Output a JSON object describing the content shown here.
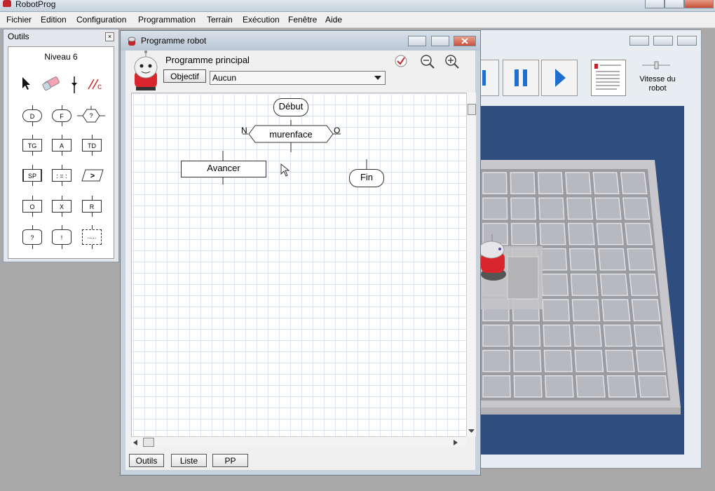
{
  "app": {
    "title": "RobotProg"
  },
  "menu": [
    "Fichier",
    "Edition",
    "Configuration",
    "Programmation",
    "Terrain",
    "Exécution",
    "Fenêtre",
    "Aide"
  ],
  "outils_panel": {
    "title": "Outils",
    "close": "×",
    "level": "Niveau 6",
    "tools": [
      {
        "label": "D"
      },
      {
        "label": "F"
      },
      {
        "label": "?"
      },
      {
        "label": "TG"
      },
      {
        "label": "A"
      },
      {
        "label": "TD"
      },
      {
        "label": "SP"
      },
      {
        "label": ": = :"
      },
      {
        "label": ">"
      },
      {
        "label": "O"
      },
      {
        "label": "X"
      },
      {
        "label": "R"
      },
      {
        "label": "?"
      },
      {
        "label": "!"
      },
      {
        "label": "....."
      }
    ]
  },
  "program_window": {
    "title": "Programme robot",
    "heading": "Programme principal",
    "objectif_button": "Objectif",
    "objective_select": "Aucun",
    "flowchart": {
      "start": "Début",
      "condition": "murenface",
      "cond_left": "N",
      "cond_right": "O",
      "action": "Avancer",
      "end": "Fin"
    },
    "bottom_tabs": [
      "Outils",
      "Liste",
      "PP"
    ]
  },
  "right_panel": {
    "speed_label_1": "Vitesse du",
    "speed_label_2": "robot"
  },
  "colors": {
    "scene_bg": "#2f4d7f",
    "play_blue": "#1f6fd0",
    "robot_red": "#d9262c"
  }
}
